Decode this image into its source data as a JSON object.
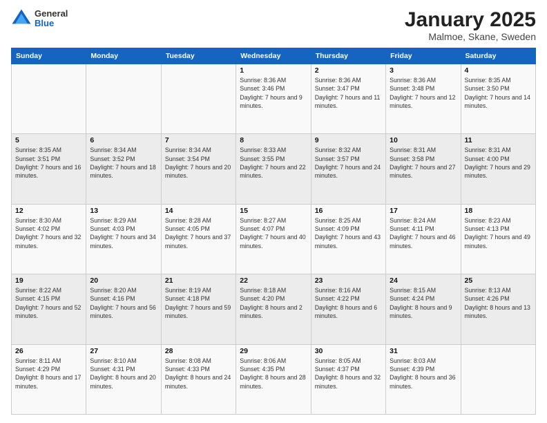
{
  "logo": {
    "general": "General",
    "blue": "Blue"
  },
  "title": "January 2025",
  "subtitle": "Malmoe, Skane, Sweden",
  "days_of_week": [
    "Sunday",
    "Monday",
    "Tuesday",
    "Wednesday",
    "Thursday",
    "Friday",
    "Saturday"
  ],
  "weeks": [
    [
      {
        "day": "",
        "sunrise": "",
        "sunset": "",
        "daylight": ""
      },
      {
        "day": "",
        "sunrise": "",
        "sunset": "",
        "daylight": ""
      },
      {
        "day": "",
        "sunrise": "",
        "sunset": "",
        "daylight": ""
      },
      {
        "day": "1",
        "sunrise": "Sunrise: 8:36 AM",
        "sunset": "Sunset: 3:46 PM",
        "daylight": "Daylight: 7 hours and 9 minutes."
      },
      {
        "day": "2",
        "sunrise": "Sunrise: 8:36 AM",
        "sunset": "Sunset: 3:47 PM",
        "daylight": "Daylight: 7 hours and 11 minutes."
      },
      {
        "day": "3",
        "sunrise": "Sunrise: 8:36 AM",
        "sunset": "Sunset: 3:48 PM",
        "daylight": "Daylight: 7 hours and 12 minutes."
      },
      {
        "day": "4",
        "sunrise": "Sunrise: 8:35 AM",
        "sunset": "Sunset: 3:50 PM",
        "daylight": "Daylight: 7 hours and 14 minutes."
      }
    ],
    [
      {
        "day": "5",
        "sunrise": "Sunrise: 8:35 AM",
        "sunset": "Sunset: 3:51 PM",
        "daylight": "Daylight: 7 hours and 16 minutes."
      },
      {
        "day": "6",
        "sunrise": "Sunrise: 8:34 AM",
        "sunset": "Sunset: 3:52 PM",
        "daylight": "Daylight: 7 hours and 18 minutes."
      },
      {
        "day": "7",
        "sunrise": "Sunrise: 8:34 AM",
        "sunset": "Sunset: 3:54 PM",
        "daylight": "Daylight: 7 hours and 20 minutes."
      },
      {
        "day": "8",
        "sunrise": "Sunrise: 8:33 AM",
        "sunset": "Sunset: 3:55 PM",
        "daylight": "Daylight: 7 hours and 22 minutes."
      },
      {
        "day": "9",
        "sunrise": "Sunrise: 8:32 AM",
        "sunset": "Sunset: 3:57 PM",
        "daylight": "Daylight: 7 hours and 24 minutes."
      },
      {
        "day": "10",
        "sunrise": "Sunrise: 8:31 AM",
        "sunset": "Sunset: 3:58 PM",
        "daylight": "Daylight: 7 hours and 27 minutes."
      },
      {
        "day": "11",
        "sunrise": "Sunrise: 8:31 AM",
        "sunset": "Sunset: 4:00 PM",
        "daylight": "Daylight: 7 hours and 29 minutes."
      }
    ],
    [
      {
        "day": "12",
        "sunrise": "Sunrise: 8:30 AM",
        "sunset": "Sunset: 4:02 PM",
        "daylight": "Daylight: 7 hours and 32 minutes."
      },
      {
        "day": "13",
        "sunrise": "Sunrise: 8:29 AM",
        "sunset": "Sunset: 4:03 PM",
        "daylight": "Daylight: 7 hours and 34 minutes."
      },
      {
        "day": "14",
        "sunrise": "Sunrise: 8:28 AM",
        "sunset": "Sunset: 4:05 PM",
        "daylight": "Daylight: 7 hours and 37 minutes."
      },
      {
        "day": "15",
        "sunrise": "Sunrise: 8:27 AM",
        "sunset": "Sunset: 4:07 PM",
        "daylight": "Daylight: 7 hours and 40 minutes."
      },
      {
        "day": "16",
        "sunrise": "Sunrise: 8:25 AM",
        "sunset": "Sunset: 4:09 PM",
        "daylight": "Daylight: 7 hours and 43 minutes."
      },
      {
        "day": "17",
        "sunrise": "Sunrise: 8:24 AM",
        "sunset": "Sunset: 4:11 PM",
        "daylight": "Daylight: 7 hours and 46 minutes."
      },
      {
        "day": "18",
        "sunrise": "Sunrise: 8:23 AM",
        "sunset": "Sunset: 4:13 PM",
        "daylight": "Daylight: 7 hours and 49 minutes."
      }
    ],
    [
      {
        "day": "19",
        "sunrise": "Sunrise: 8:22 AM",
        "sunset": "Sunset: 4:15 PM",
        "daylight": "Daylight: 7 hours and 52 minutes."
      },
      {
        "day": "20",
        "sunrise": "Sunrise: 8:20 AM",
        "sunset": "Sunset: 4:16 PM",
        "daylight": "Daylight: 7 hours and 56 minutes."
      },
      {
        "day": "21",
        "sunrise": "Sunrise: 8:19 AM",
        "sunset": "Sunset: 4:18 PM",
        "daylight": "Daylight: 7 hours and 59 minutes."
      },
      {
        "day": "22",
        "sunrise": "Sunrise: 8:18 AM",
        "sunset": "Sunset: 4:20 PM",
        "daylight": "Daylight: 8 hours and 2 minutes."
      },
      {
        "day": "23",
        "sunrise": "Sunrise: 8:16 AM",
        "sunset": "Sunset: 4:22 PM",
        "daylight": "Daylight: 8 hours and 6 minutes."
      },
      {
        "day": "24",
        "sunrise": "Sunrise: 8:15 AM",
        "sunset": "Sunset: 4:24 PM",
        "daylight": "Daylight: 8 hours and 9 minutes."
      },
      {
        "day": "25",
        "sunrise": "Sunrise: 8:13 AM",
        "sunset": "Sunset: 4:26 PM",
        "daylight": "Daylight: 8 hours and 13 minutes."
      }
    ],
    [
      {
        "day": "26",
        "sunrise": "Sunrise: 8:11 AM",
        "sunset": "Sunset: 4:29 PM",
        "daylight": "Daylight: 8 hours and 17 minutes."
      },
      {
        "day": "27",
        "sunrise": "Sunrise: 8:10 AM",
        "sunset": "Sunset: 4:31 PM",
        "daylight": "Daylight: 8 hours and 20 minutes."
      },
      {
        "day": "28",
        "sunrise": "Sunrise: 8:08 AM",
        "sunset": "Sunset: 4:33 PM",
        "daylight": "Daylight: 8 hours and 24 minutes."
      },
      {
        "day": "29",
        "sunrise": "Sunrise: 8:06 AM",
        "sunset": "Sunset: 4:35 PM",
        "daylight": "Daylight: 8 hours and 28 minutes."
      },
      {
        "day": "30",
        "sunrise": "Sunrise: 8:05 AM",
        "sunset": "Sunset: 4:37 PM",
        "daylight": "Daylight: 8 hours and 32 minutes."
      },
      {
        "day": "31",
        "sunrise": "Sunrise: 8:03 AM",
        "sunset": "Sunset: 4:39 PM",
        "daylight": "Daylight: 8 hours and 36 minutes."
      },
      {
        "day": "",
        "sunrise": "",
        "sunset": "",
        "daylight": ""
      }
    ]
  ]
}
